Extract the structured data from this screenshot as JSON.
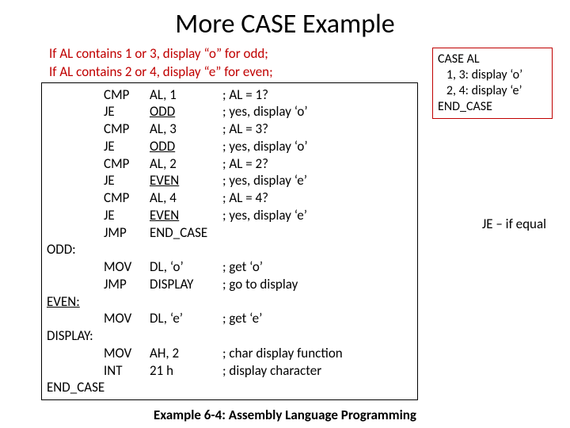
{
  "title": "More CASE Example",
  "intro_line1": "If AL contains 1 or 3, display “o” for odd;",
  "intro_line2": "If AL contains 2 or 4, display “e” for even;",
  "code": [
    {
      "label": "",
      "op": "CMP",
      "arg": "AL, 1",
      "cmt": "; AL = 1?",
      "u": false
    },
    {
      "label": "",
      "op": "JE",
      "arg": "ODD",
      "cmt": "; yes, display ‘o’",
      "u": true
    },
    {
      "label": "",
      "op": "CMP",
      "arg": "AL, 3",
      "cmt": "; AL = 3?",
      "u": false
    },
    {
      "label": "",
      "op": "JE",
      "arg": "ODD",
      "cmt": "; yes, display ‘o’",
      "u": true
    },
    {
      "label": "",
      "op": "CMP",
      "arg": "AL, 2",
      "cmt": "; AL = 2?",
      "u": false
    },
    {
      "label": "",
      "op": "JE",
      "arg": "EVEN",
      "cmt": "; yes, display ‘e’",
      "u": true
    },
    {
      "label": "",
      "op": "CMP",
      "arg": "AL, 4",
      "cmt": "; AL = 4?",
      "u": false
    },
    {
      "label": "",
      "op": "JE",
      "arg": "EVEN",
      "cmt": "; yes, display ‘e’",
      "u": true
    },
    {
      "label": "",
      "op": "JMP",
      "arg": "END_CASE",
      "cmt": "",
      "u": false
    },
    {
      "label": "ODD:",
      "op": "",
      "arg": "",
      "cmt": "",
      "u": false
    },
    {
      "label": "",
      "op": "MOV",
      "arg": "DL, ‘o’",
      "cmt": "; get ‘o’",
      "u": false
    },
    {
      "label": "",
      "op": "JMP",
      "arg": "DISPLAY",
      "cmt": "; go to display",
      "u": false
    },
    {
      "label": "EVEN:",
      "op": "",
      "arg": "",
      "cmt": "",
      "u": false,
      "lu": true
    },
    {
      "label": "",
      "op": "MOV",
      "arg": "DL, ‘e’",
      "cmt": "; get ‘e’",
      "u": false
    },
    {
      "label": "DISPLAY:",
      "op": "",
      "arg": "",
      "cmt": "",
      "u": false
    },
    {
      "label": "",
      "op": "MOV",
      "arg": "AH, 2",
      "cmt": "; char display function",
      "u": false
    },
    {
      "label": "",
      "op": "INT",
      "arg": "21 h",
      "cmt": "; display character",
      "u": false
    },
    {
      "label": "END_CASE",
      "op": "",
      "arg": "",
      "cmt": "",
      "u": false
    }
  ],
  "pseudo": {
    "l1": "CASE   AL",
    "l2": "   1, 3: display ‘o’",
    "l3": "   2, 4: display ‘e’",
    "l4": "END_CASE"
  },
  "note": "JE – if equal",
  "caption": "Example 6-4: Assembly Language Programming"
}
